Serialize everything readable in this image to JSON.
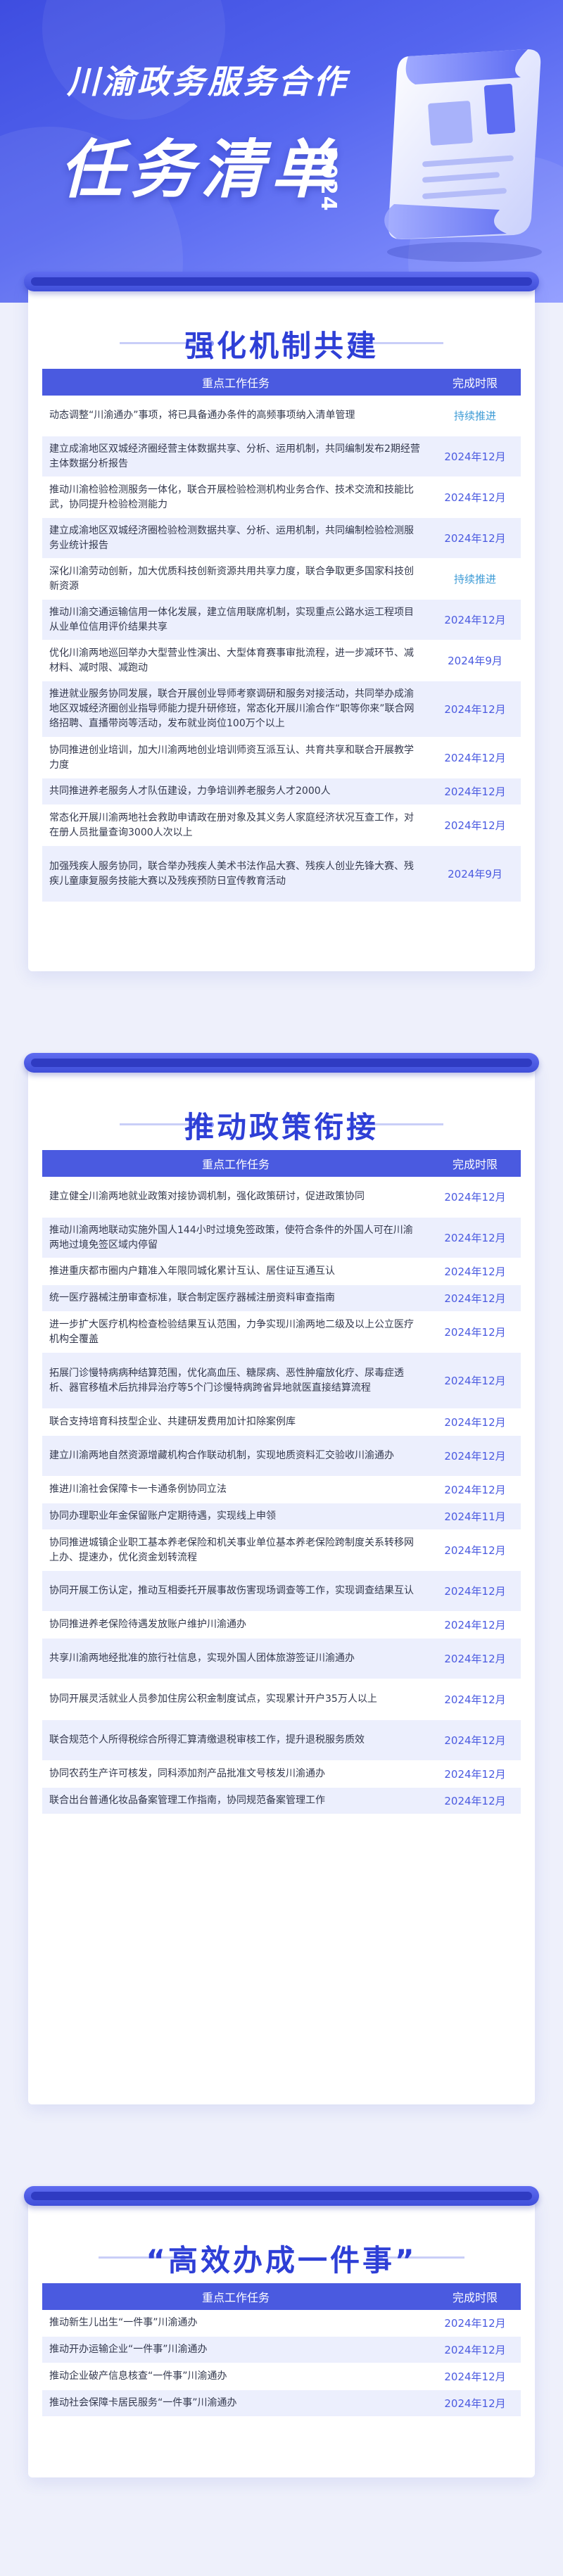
{
  "hero": {
    "title_line1": "川渝政务服务合作",
    "title_line2": "任务清单",
    "year": "2024"
  },
  "columns": {
    "task": "重点工作任务",
    "time": "完成时限"
  },
  "sections": [
    {
      "title": "强化机制共建",
      "rows": [
        {
          "task": "动态调整“川渝通办”事项，将已具备通办条件的高频事项纳入清单管理",
          "time": "持续推进",
          "h": 58
        },
        {
          "task": "建立成渝地区双城经济圈经营主体数据共享、分析、运用机制，共同编制发布2期经营主体数据分析报告",
          "time": "2024年12月",
          "h": 58
        },
        {
          "task": "推动川渝检验检测服务一体化，联合开展检验检测机构业务合作、技术交流和技能比武，协同提升检验检测能力",
          "time": "2024年12月",
          "h": 58
        },
        {
          "task": "建立成渝地区双城经济圈检验检测数据共享、分析、运用机制，共同编制检验检测服务业统计报告",
          "time": "2024年12月",
          "h": 58
        },
        {
          "task": "深化川渝劳动创新，加大优质科技创新资源共用共享力度，联合争取更多国家科技创新资源",
          "time": "持续推进",
          "h": 58
        },
        {
          "task": "推动川渝交通运输信用一体化发展，建立信用联席机制，实现重点公路水运工程项目从业单位信用评价结果共享",
          "time": "2024年12月",
          "h": 58
        },
        {
          "task": "优化川渝两地巡回举办大型营业性演出、大型体育赛事审批流程，进一步减环节、减材料、减时限、减跑动",
          "time": "2024年9月",
          "h": 58
        },
        {
          "task": "推进就业服务协同发展，联合开展创业导师考察调研和服务对接活动，共同举办成渝地区双城经济圈创业指导师能力提升研修班，常态化开展川渝合作“职等你来”联合网络招聘、直播带岗等活动，发布就业岗位100万个以上",
          "time": "2024年12月",
          "h": 80
        },
        {
          "task": "协同推进创业培训，加大川渝两地创业培训师资互派互认、共育共享和联合开展教学力度",
          "time": "2024年12月",
          "h": 58
        },
        {
          "task": "共同推进养老服务人才队伍建设，力争培训养老服务人才2000人",
          "time": "2024年12月",
          "h": 38
        },
        {
          "task": "常态化开展川渝两地社会救助申请政在册对象及其义务人家庭经济状况互查工作，对在册人员批量查询3000人次以上",
          "time": "2024年12月",
          "h": 58
        },
        {
          "task": "加强残疾人服务协同，联合举办残疾人美术书法作品大赛、残疾人创业先锋大赛、残疾儿童康复服务技能大赛以及残疾预防日宣传教育活动",
          "time": "2024年9月",
          "h": 80
        }
      ]
    },
    {
      "title": "推动政策衔接",
      "rows": [
        {
          "task": "建立健全川渝两地就业政策对接协调机制，强化政策研讨，促进政策协同",
          "time": "2024年12月",
          "h": 58
        },
        {
          "task": "推动川渝两地联动实施外国人144小时过境免签政策，使符合条件的外国人可在川渝两地过境免签区域内停留",
          "time": "2024年12月",
          "h": 58
        },
        {
          "task": "推进重庆都市圈内户籍准入年限同城化累计互认、居住证互通互认",
          "time": "2024年12月",
          "h": 38
        },
        {
          "task": "统一医疗器械注册审查标准，联合制定医疗器械注册资料审查指南",
          "time": "2024年12月",
          "h": 38
        },
        {
          "task": "进一步扩大医疗机构检查检验结果互认范围，力争实现川渝两地二级及以上公立医疗机构全覆盖",
          "time": "2024年12月",
          "h": 58
        },
        {
          "task": "拓展门诊慢特病病种结算范围，优化高血压、糖尿病、恶性肿瘤放化疗、尿毒症透析、器官移植术后抗排异治疗等5个门诊慢特病跨省异地就医直接结算流程",
          "time": "2024年12月",
          "h": 80
        },
        {
          "task": "联合支持培育科技型企业、共建研发费用加计扣除案例库",
          "time": "2024年12月",
          "h": 38
        },
        {
          "task": "建立川渝两地自然资源增藏机构合作联动机制，实现地质资料汇交验收川渝通办",
          "time": "2024年12月",
          "h": 58
        },
        {
          "task": "推进川渝社会保障卡一卡通条例协同立法",
          "time": "2024年12月",
          "h": 38
        },
        {
          "task": "协同办理职业年金保留账户定期待遇，实现线上申领",
          "time": "2024年11月",
          "h": 38
        },
        {
          "task": "协同推进城镇企业职工基本养老保险和机关事业单位基本养老保险跨制度关系转移网上办、提速办，优化资金划转流程",
          "time": "2024年12月",
          "h": 58
        },
        {
          "task": "协同开展工伤认定，推动互相委托开展事故伤害现场调查等工作，实现调查结果互认",
          "time": "2024年12月",
          "h": 58
        },
        {
          "task": "协同推进养老保险待遇发放账户维护川渝通办",
          "time": "2024年12月",
          "h": 38
        },
        {
          "task": "共享川渝两地经批准的旅行社信息，实现外国人团体旅游签证川渝通办",
          "time": "2024年12月",
          "h": 58
        },
        {
          "task": "协同开展灵活就业人员参加住房公积金制度试点，实现累计开户35万人以上",
          "time": "2024年12月",
          "h": 58
        },
        {
          "task": "联合规范个人所得税综合所得汇算清缴退税审核工作，提升退税服务质效",
          "time": "2024年12月",
          "h": 58
        },
        {
          "task": "协同农药生产许可核发，同科添加剂产品批准文号核发川渝通办",
          "time": "2024年12月",
          "h": 38
        },
        {
          "task": "联合出台普通化妆品备案管理工作指南，协同规范备案管理工作",
          "time": "2024年12月",
          "h": 38
        }
      ]
    },
    {
      "title": "“高效办成一件事”",
      "rows": [
        {
          "task": "推动新生儿出生“一件事”川渝通办",
          "time": "2024年12月",
          "h": 38
        },
        {
          "task": "推动开办运输企业“一件事”川渝通办",
          "time": "2024年12月",
          "h": 38
        },
        {
          "task": "推动企业破产信息核查“一件事”川渝通办",
          "time": "2024年12月",
          "h": 38
        },
        {
          "task": "推动社会保障卡居民服务“一件事”川渝通办",
          "time": "2024年12月",
          "h": 38
        }
      ]
    }
  ],
  "colors": {
    "accent": "#4a5ae0",
    "title": "#2e3fd6",
    "stripe": "#eceffd",
    "teal": "#3d9bd6"
  }
}
